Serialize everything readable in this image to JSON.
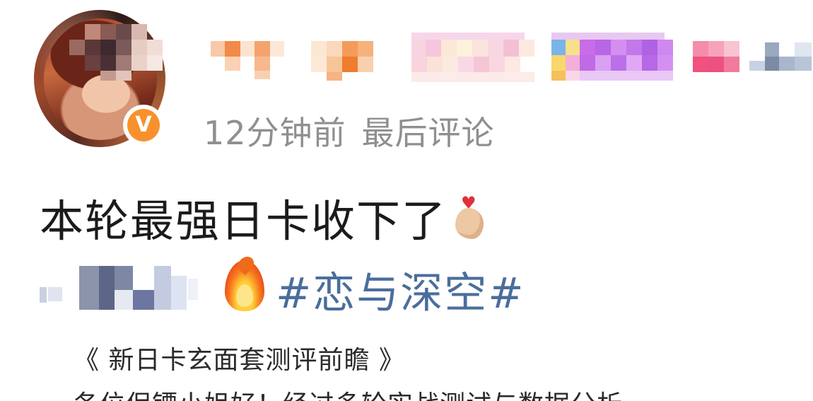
{
  "post": {
    "meta": {
      "time": "12分钟前",
      "status": "最后评论"
    },
    "title": "本轮最强日卡收下了",
    "topic": "#恋与深空#",
    "article_title": "《 新日卡玄面套测评前瞻 》",
    "article_body": "各位保镖小姐好！经过多轮实战测试与数据分析"
  },
  "icons": {
    "verified_badge": "v-badge-icon",
    "verified_letter": "V",
    "heart_hand": "finger-heart-icon",
    "heart": "♥",
    "fire": "fire-icon"
  },
  "colors": {
    "meta_text": "#8f8f8f",
    "body_text": "#1b1b1b",
    "topic_link": "#4a6e9c",
    "verified_orange": "#f8912d"
  }
}
